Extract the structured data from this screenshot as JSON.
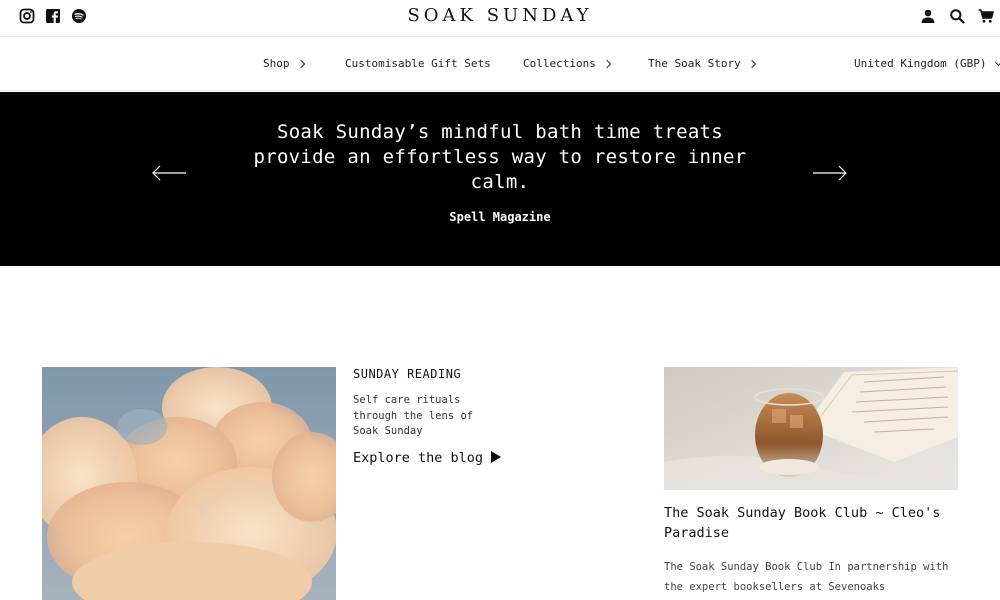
{
  "header": {
    "brand": "SOAK SUNDAY",
    "social_icons": [
      "instagram-icon",
      "facebook-icon",
      "spotify-icon"
    ],
    "utility_icons": [
      "account-icon",
      "search-icon",
      "cart-icon"
    ]
  },
  "nav": {
    "items": [
      {
        "label": "Shop",
        "has_chevron": true
      },
      {
        "label": "Customisable Gift Sets",
        "has_chevron": false
      },
      {
        "label": "Collections",
        "has_chevron": true
      },
      {
        "label": "The Soak Story",
        "has_chevron": true
      }
    ],
    "currency": "United Kingdom (GBP)"
  },
  "hero": {
    "quote": "Soak Sunday’s mindful bath time treats provide an effortless way to restore inner calm.",
    "source": "Spell Magazine",
    "prev_icon": "arrow-left-icon",
    "next_icon": "arrow-right-icon",
    "background": "#000000"
  },
  "reading": {
    "label": "SUNDAY READING",
    "description": "Self care rituals through the lens of Soak Sunday",
    "link_label": "Explore the blog"
  },
  "post": {
    "title": "The Soak Sunday Book Club ~ Cleo's Paradise",
    "excerpt": "The Soak Sunday Book Club In partnership with the expert booksellers at Sevenoaks"
  }
}
